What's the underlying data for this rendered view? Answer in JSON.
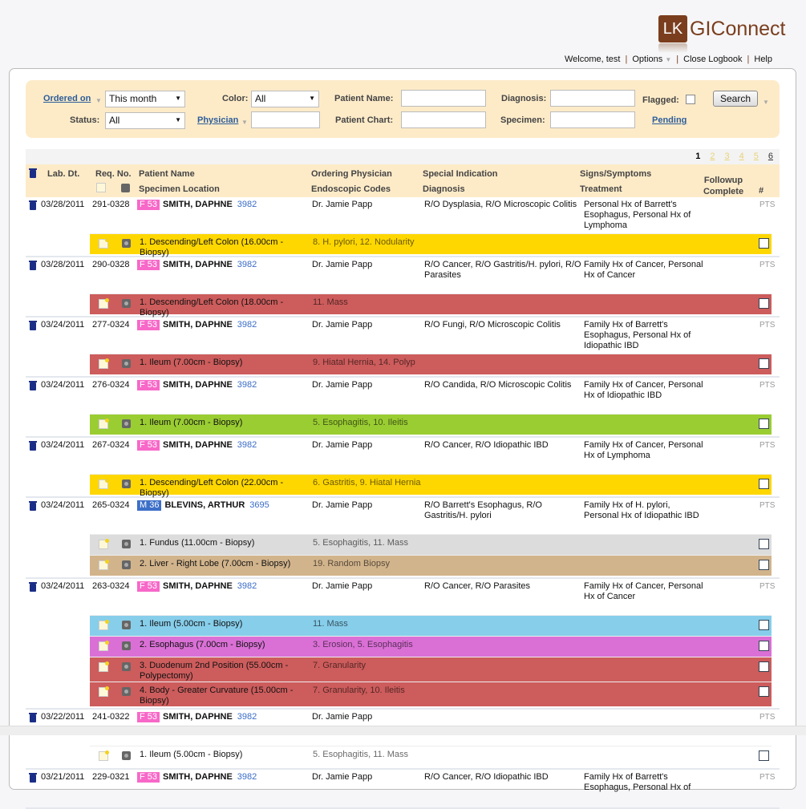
{
  "logo": {
    "mark": "LK",
    "name": "GIConnect"
  },
  "topnav": {
    "welcome": "Welcome, test",
    "options": "Options",
    "close": "Close Logbook",
    "help": "Help"
  },
  "filters": {
    "ordered_on": "Ordered on",
    "ordered_value": "This month",
    "color_label": "Color:",
    "color_value": "All",
    "patient_name_label": "Patient Name:",
    "diagnosis_label": "Diagnosis:",
    "flagged_label": "Flagged:",
    "search": "Search",
    "status_label": "Status:",
    "status_value": "All",
    "physician": "Physician",
    "patient_chart_label": "Patient Chart:",
    "specimen_label": "Specimen:",
    "pending": "Pending"
  },
  "pager": [
    "1",
    "2",
    "3",
    "4",
    "5",
    "6"
  ],
  "headers": {
    "lab_dt": "Lab. Dt.",
    "req_no": "Req. No.",
    "patient_name": "Patient Name",
    "specimen_location": "Specimen Location",
    "ordering_physician": "Ordering Physician",
    "endoscopic_codes": "Endoscopic Codes",
    "special_indication": "Special Indication",
    "diagnosis": "Diagnosis",
    "signs": "Signs/Symptoms",
    "treatment": "Treatment",
    "followup": "Followup Complete",
    "num": "#"
  },
  "colors": {
    "yellow": "#FFD700",
    "red": "#CD5C5C",
    "green": "#9ACD32",
    "gray": "#DCDCDC",
    "tan": "#D2B48C",
    "blue": "#87CEEB",
    "orchid": "#DA70D6",
    "white": "#FFFFFF",
    "female": "#F768C8",
    "male": "#3C6FC8"
  },
  "records": [
    {
      "date": "03/28/2011",
      "req": "291-0328",
      "sex": "F 53",
      "name": "SMITH, DAPHNE",
      "pid": "3982",
      "physician": "Dr. Jamie Papp",
      "indication": "R/O Dysplasia, R/O Microscopic Colitis",
      "signs": "Personal Hx of Barrett's Esophagus, Personal Hx of Lymphoma",
      "pts": "PTS",
      "specimens": [
        {
          "loc": "1. Descending/Left Colon (16.00cm - Biopsy)",
          "codes": "8. H. pylori, 12. Nodularity",
          "color": "yellow"
        }
      ]
    },
    {
      "date": "03/28/2011",
      "req": "290-0328",
      "sex": "F 53",
      "name": "SMITH, DAPHNE",
      "pid": "3982",
      "physician": "Dr. Jamie Papp",
      "indication": "R/O Cancer, R/O Gastritis/H. pylori, R/O Parasites",
      "signs": "Family Hx of Cancer, Personal Hx of Cancer",
      "pts": "PTS",
      "specimens": [
        {
          "loc": "1. Descending/Left Colon (18.00cm - Biopsy)",
          "codes": "11. Mass",
          "color": "red"
        }
      ]
    },
    {
      "date": "03/24/2011",
      "req": "277-0324",
      "sex": "F 53",
      "name": "SMITH, DAPHNE",
      "pid": "3982",
      "physician": "Dr. Jamie Papp",
      "indication": "R/O Fungi, R/O Microscopic Colitis",
      "signs": "Family Hx of Barrett's Esophagus, Personal Hx of Idiopathic IBD",
      "pts": "PTS",
      "specimens": [
        {
          "loc": "1. Ileum (7.00cm - Biopsy)",
          "codes": "9. Hiatal Hernia, 14. Polyp",
          "color": "red"
        }
      ]
    },
    {
      "date": "03/24/2011",
      "req": "276-0324",
      "sex": "F 53",
      "name": "SMITH, DAPHNE",
      "pid": "3982",
      "physician": "Dr. Jamie Papp",
      "indication": "R/O Candida, R/O Microscopic Colitis",
      "signs": "Family Hx of Cancer, Personal Hx of Idiopathic IBD",
      "pts": "PTS",
      "specimens": [
        {
          "loc": "1. Ileum (7.00cm - Biopsy)",
          "codes": "5. Esophagitis, 10. Ileitis",
          "color": "green"
        }
      ]
    },
    {
      "date": "03/24/2011",
      "req": "267-0324",
      "sex": "F 53",
      "name": "SMITH, DAPHNE",
      "pid": "3982",
      "physician": "Dr. Jamie Papp",
      "indication": "R/O Cancer, R/O Idiopathic IBD",
      "signs": "Family Hx of Cancer, Personal Hx of Lymphoma",
      "pts": "PTS",
      "specimens": [
        {
          "loc": "1. Descending/Left Colon (22.00cm - Biopsy)",
          "codes": "6. Gastritis, 9. Hiatal Hernia",
          "color": "yellow"
        }
      ]
    },
    {
      "date": "03/24/2011",
      "req": "265-0324",
      "sex": "M 36",
      "name": "BLEVINS, ARTHUR",
      "pid": "3695",
      "physician": "Dr. Jamie Papp",
      "indication": "R/O Barrett's Esophagus, R/O Gastritis/H. pylori",
      "signs": "Family Hx of H. pylori, Personal Hx of Idiopathic IBD",
      "pts": "PTS",
      "specimens": [
        {
          "loc": "1. Fundus (11.00cm - Biopsy)",
          "codes": "5. Esophagitis, 11. Mass",
          "color": "gray"
        },
        {
          "loc": "2. Liver - Right Lobe (7.00cm - Biopsy)",
          "codes": "19. Random Biopsy",
          "color": "tan"
        }
      ]
    },
    {
      "date": "03/24/2011",
      "req": "263-0324",
      "sex": "F 53",
      "name": "SMITH, DAPHNE",
      "pid": "3982",
      "physician": "Dr. Jamie Papp",
      "indication": "R/O Cancer, R/O Parasites",
      "signs": "Family Hx of Cancer, Personal Hx of Cancer",
      "pts": "PTS",
      "specimens": [
        {
          "loc": "1. Ileum (5.00cm - Biopsy)",
          "codes": "11. Mass",
          "color": "blue"
        },
        {
          "loc": "2. Esophagus (7.00cm - Biopsy)",
          "codes": "3. Erosion, 5. Esophagitis",
          "color": "orchid"
        },
        {
          "loc": "3. Duodenum 2nd Position (55.00cm - Polypectomy)",
          "codes": "7. Granularity",
          "color": "red"
        },
        {
          "loc": "4. Body - Greater Curvature (15.00cm - Biopsy)",
          "codes": "7. Granularity, 10. Ileitis",
          "color": "red"
        }
      ]
    },
    {
      "date": "03/22/2011",
      "req": "241-0322",
      "sex": "F 53",
      "name": "SMITH, DAPHNE",
      "pid": "3982",
      "physician": "Dr. Jamie Papp",
      "indication": "",
      "signs": "",
      "pts": "PTS",
      "specimens": [
        {
          "loc": "1. Ileum (5.00cm - Biopsy)",
          "codes": "5. Esophagitis, 11. Mass",
          "color": "white"
        }
      ]
    },
    {
      "date": "03/21/2011",
      "req": "229-0321",
      "sex": "F 53",
      "name": "SMITH, DAPHNE",
      "pid": "3982",
      "physician": "Dr. Jamie Papp",
      "indication": "R/O Cancer, R/O Idiopathic IBD",
      "signs": "Family Hx of Barrett's Esophagus, Personal Hx of",
      "pts": "PTS",
      "specimens": []
    }
  ]
}
